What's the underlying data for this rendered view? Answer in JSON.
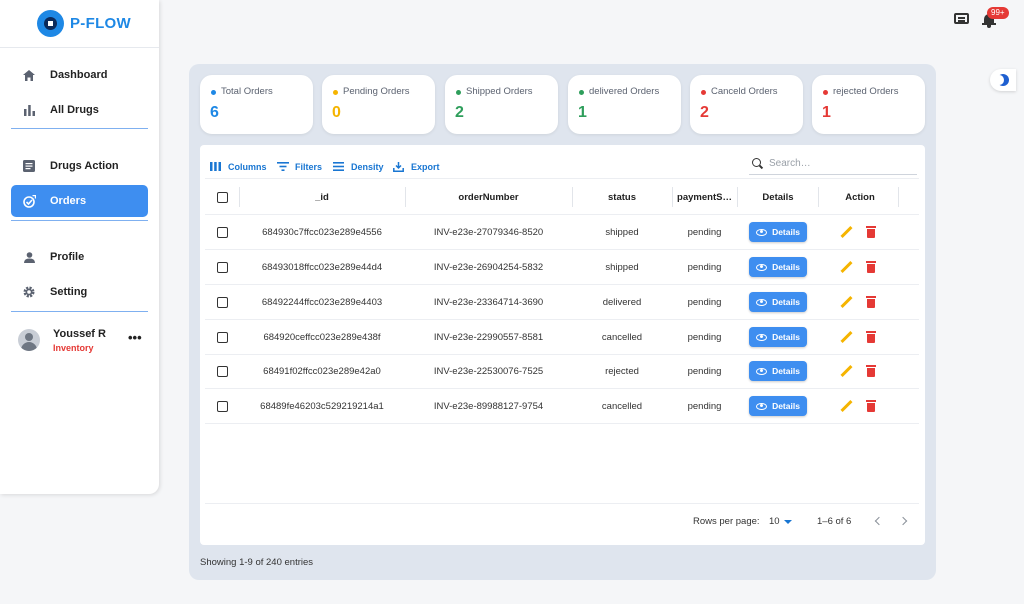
{
  "brand": {
    "name": "P-FLOW"
  },
  "sidebar": {
    "items": [
      {
        "label": "Dashboard",
        "icon": "home-icon"
      },
      {
        "label": "All Drugs",
        "icon": "bar-chart-icon"
      },
      {
        "label": "Drugs Action",
        "icon": "list-icon"
      },
      {
        "label": "Orders",
        "icon": "orders-icon",
        "active": true
      },
      {
        "label": "Profile",
        "icon": "person-icon"
      },
      {
        "label": "Setting",
        "icon": "gear-icon"
      }
    ],
    "user": {
      "name": "Youssef R",
      "role": "Inventory",
      "more": "•••"
    }
  },
  "topbar": {
    "notification_count": "99+"
  },
  "stats": [
    {
      "title": "Total Orders",
      "value": "6",
      "color": "#1e88e5"
    },
    {
      "title": "Pending Orders",
      "value": "0",
      "color": "#f5b400"
    },
    {
      "title": "Shipped Orders",
      "value": "2",
      "color": "#2e9e5b"
    },
    {
      "title": "delivered Orders",
      "value": "1",
      "color": "#2e9e5b"
    },
    {
      "title": "Canceld Orders",
      "value": "2",
      "color": "#e53935"
    },
    {
      "title": "rejected Orders",
      "value": "1",
      "color": "#e53935"
    }
  ],
  "toolbar": {
    "columns": "Columns",
    "filters": "Filters",
    "density": "Density",
    "export": "Export",
    "search_placeholder": "Search…"
  },
  "table": {
    "headers": [
      "_id",
      "orderNumber",
      "status",
      "paymentS…",
      "Details",
      "Action"
    ],
    "details_label": "Details",
    "rows": [
      {
        "id": "684930c7ffcc023e289e4556",
        "order": "INV-e23e-27079346-8520",
        "status": "shipped",
        "payment": "pending"
      },
      {
        "id": "68493018ffcc023e289e44d4",
        "order": "INV-e23e-26904254-5832",
        "status": "shipped",
        "payment": "pending"
      },
      {
        "id": "68492244ffcc023e289e4403",
        "order": "INV-e23e-23364714-3690",
        "status": "delivered",
        "payment": "pending"
      },
      {
        "id": "684920ceffcc023e289e438f",
        "order": "INV-e23e-22990557-8581",
        "status": "cancelled",
        "payment": "pending"
      },
      {
        "id": "68491f02ffcc023e289e42a0",
        "order": "INV-e23e-22530076-7525",
        "status": "rejected",
        "payment": "pending"
      },
      {
        "id": "68489fe46203c529219214a1",
        "order": "INV-e23e-89988127-9754",
        "status": "cancelled",
        "payment": "pending"
      }
    ]
  },
  "pagination": {
    "rows_label": "Rows per page:",
    "rows_value": "10",
    "range": "1–6 of 6"
  },
  "footer": {
    "showing": "Showing 1-9 of 240 entries"
  }
}
